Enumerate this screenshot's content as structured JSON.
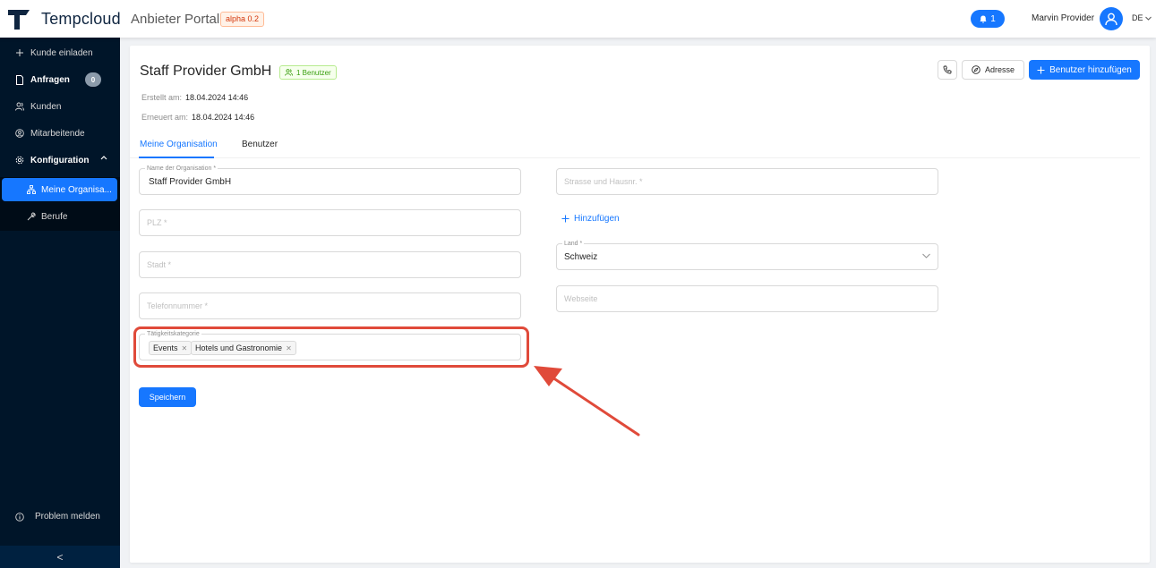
{
  "header": {
    "brand": "Tempcloud",
    "portal": "Anbieter Portal",
    "version_badge": "alpha 0.2",
    "notifications_count": "1",
    "user_name": "Marvin Provider",
    "language": "DE"
  },
  "sidebar": {
    "items": [
      {
        "label": "Kunde einladen",
        "icon": "plus-icon"
      },
      {
        "label": "Anfragen",
        "icon": "document-icon",
        "badge": "0"
      },
      {
        "label": "Kunden",
        "icon": "users-icon"
      },
      {
        "label": "Mitarbeitende",
        "icon": "globe-users-icon"
      },
      {
        "label": "Konfiguration",
        "icon": "gear-icon"
      }
    ],
    "sub_items": [
      {
        "label": "Meine Organisa...",
        "icon": "organization-icon"
      },
      {
        "label": "Berufe",
        "icon": "tool-icon"
      }
    ],
    "problem_label": "Problem melden",
    "collapse_symbol": "<"
  },
  "page": {
    "title": "Staff Provider GmbH",
    "users_tag": "1 Benutzer",
    "created_label": "Erstellt am",
    "created_value": "18.04.2024 14:46",
    "updated_label": "Erneuert am",
    "updated_value": "18.04.2024 14:46",
    "address_button": "Adresse",
    "add_user_button": "Benutzer hinzufügen",
    "tabs": [
      "Meine Organisation",
      "Benutzer"
    ]
  },
  "form": {
    "org_name_label": "Name der Organisation *",
    "org_name_value": "Staff Provider GmbH",
    "plz_placeholder": "PLZ *",
    "city_placeholder": "Stadt *",
    "phone_placeholder": "Telefonnummer *",
    "category_label": "Tätigkeitskategorie",
    "categories": [
      "Events",
      "Hotels und Gastronomie"
    ],
    "street_placeholder": "Strasse und Hausnr. *",
    "add_link": "Hinzufügen",
    "country_label": "Land *",
    "country_value": "Schweiz",
    "website_placeholder": "Webseite",
    "save_button": "Speichern"
  },
  "colors": {
    "primary": "#1677ff",
    "sidebar_bg": "#001529",
    "highlight": "#e04a3a"
  }
}
